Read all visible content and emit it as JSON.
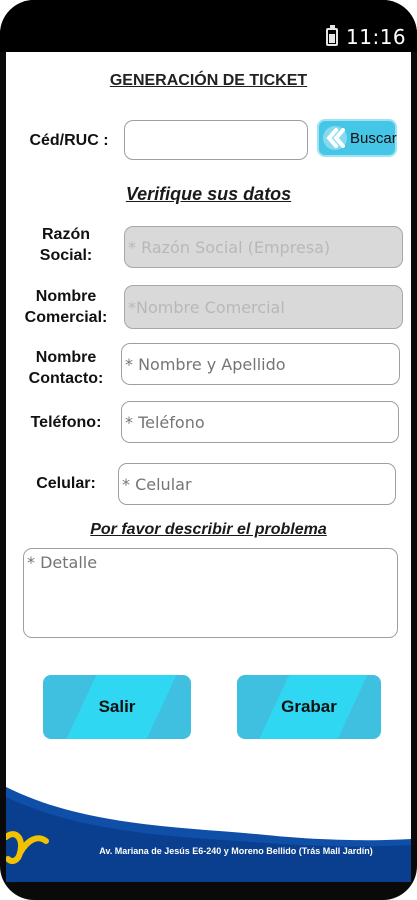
{
  "status_bar": {
    "time": "11:16",
    "battery_icon": "battery-icon"
  },
  "header": {
    "title": "GENERACIÓN DE TICKET"
  },
  "search": {
    "label": "Céd/RUC :",
    "value": "",
    "button_label": "Buscar",
    "button_icon": "double-chevron-left-icon",
    "button_color": "#45c6e6"
  },
  "verify": {
    "title": "Verifique sus datos",
    "fields": [
      {
        "label_line1": "Razón",
        "label_line2": "Social:",
        "placeholder": "* Razón Social (Empresa)"
      },
      {
        "label_line1": "Nombre",
        "label_line2": "Comercial:",
        "placeholder": "*Nombre Comercial"
      },
      {
        "label_line1": "Nombre",
        "label_line2": "Contacto:",
        "placeholder": "* Nombre y Apellido"
      },
      {
        "label_line1": "Teléfono:",
        "placeholder": "* Teléfono"
      },
      {
        "label_line1": "Celular:",
        "placeholder": "* Celular"
      }
    ]
  },
  "problem": {
    "title": "Por favor describir el problema",
    "placeholder": "* Detalle"
  },
  "actions": {
    "exit_label": "Salir",
    "save_label": "Grabar",
    "button_color": "#2fd7f3"
  },
  "footer": {
    "address": "Av. Mariana de Jesús E6-240 y Moreno Bellido (Trás Mall Jardín)",
    "brand_color": "#0f4fa8",
    "accent_color": "#f2c200"
  }
}
